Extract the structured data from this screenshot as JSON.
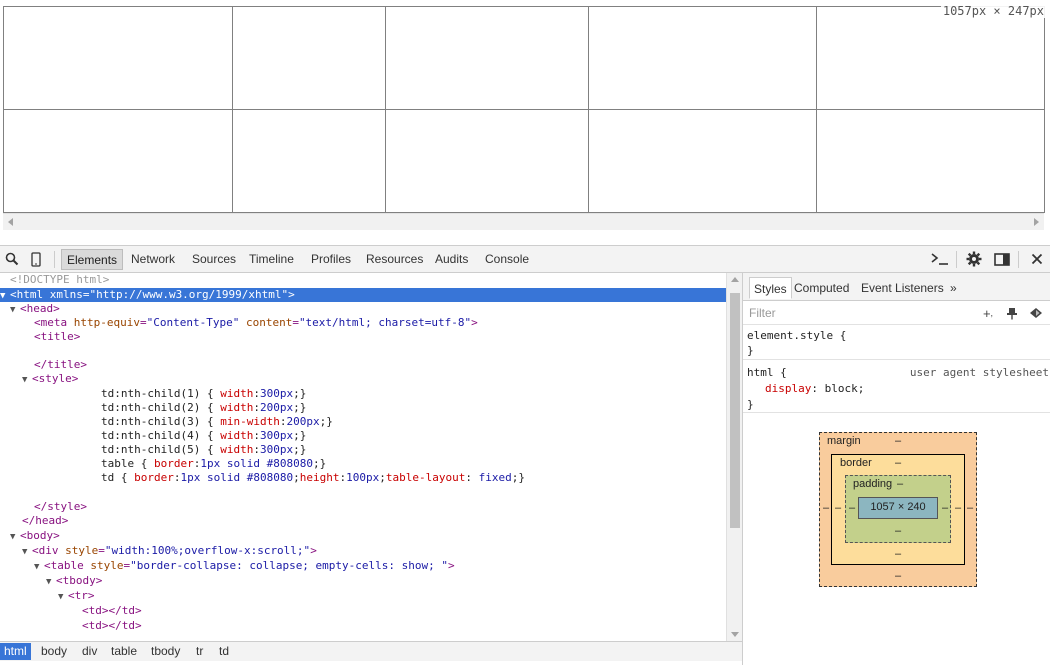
{
  "viewport": {
    "size_badge": "1057px × 247px"
  },
  "toolbar": {
    "tabs": [
      "Elements",
      "Network",
      "Sources",
      "Timeline",
      "Profiles",
      "Resources",
      "Audits",
      "Console"
    ],
    "active_tab": "Elements",
    "icons": [
      "search-icon",
      "device-mode-icon",
      "console-drawer-icon",
      "settings-icon",
      "dock-icon",
      "close-icon"
    ]
  },
  "elements": {
    "doctype": "<!DOCTYPE html>",
    "html_open": "<html xmlns=\"http://www.w3.org/1999/xhtml\">",
    "head_open": "<head>",
    "meta_tag": "<meta",
    "meta_attr1": "http-equiv",
    "meta_val1": "\"Content-Type\"",
    "meta_attr2": "content",
    "meta_val2": "\"text/html; charset=utf-8\"",
    "meta_close": ">",
    "title_open": "<title>",
    "title_close": "</title>",
    "style_open": "<style>",
    "css": [
      {
        "sel": "td:nth-child(1) { ",
        "prop": "width",
        "val": "300px",
        "tail": ";}"
      },
      {
        "sel": "td:nth-child(2) { ",
        "prop": "width",
        "val": "200px",
        "tail": ";}"
      },
      {
        "sel": "td:nth-child(3) { ",
        "prop": "min-width",
        "val": "200px",
        "tail": ";}"
      },
      {
        "sel": "td:nth-child(4) { ",
        "prop": "width",
        "val": "300px",
        "tail": ";}"
      },
      {
        "sel": "td:nth-child(5) { ",
        "prop": "width",
        "val": "300px",
        "tail": ";}"
      }
    ],
    "css_table": "table { ",
    "css_table_prop": "border",
    "css_table_val": "1px solid #808080",
    "css_td": "td { ",
    "css_td_prop1": "border",
    "css_td_val1": "1px solid #808080",
    "css_td_prop2": "height",
    "css_td_val2": "100px",
    "css_td_prop3": "table-layout",
    "css_td_val3": " fixed",
    "css_close": ";}",
    "style_close": "</style>",
    "head_close": "</head>",
    "body_open": "<body>",
    "div_tag": "<div",
    "div_attr": "style",
    "div_val": "\"width:100%;overflow-x:scroll;\"",
    "table_tag": "<table",
    "table_attr": "style",
    "table_val": "\"border-collapse: collapse; empty-cells: show; \"",
    "tbody_open": "<tbody>",
    "tr_open": "<tr>",
    "td_cell": "<td></td>"
  },
  "breadcrumbs": [
    "html",
    "body",
    "div",
    "table",
    "tbody",
    "tr",
    "td"
  ],
  "sidebar": {
    "tabs": [
      "Styles",
      "Computed",
      "Event Listeners"
    ],
    "more": "»",
    "filter_placeholder": "Filter",
    "element_style_open": "element.style {",
    "rule_close": "}",
    "html_rule_selector": "html {",
    "html_rule_source": "user agent stylesheet",
    "html_rule_prop": "display",
    "html_rule_val": "block;",
    "box_model": {
      "margin_label": "margin",
      "border_label": "border",
      "padding_label": "padding",
      "dash": "–",
      "content_size": "1057 × 240"
    }
  }
}
